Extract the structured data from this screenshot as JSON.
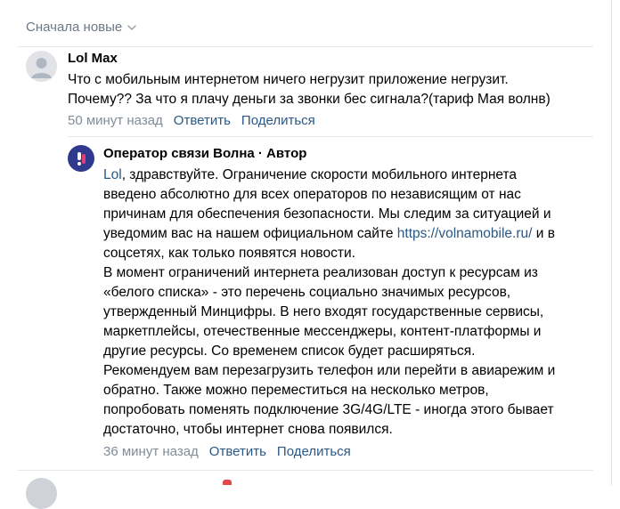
{
  "sort": {
    "label": "Сначала новые",
    "icon": "chevron-down-icon"
  },
  "comment": {
    "author": "Lol Max",
    "text": "Что с мобильным интернетом ничего негрузит приложение негрузит.\nПочему?? За что я плачу деньги за звонки бес сигнала?(тариф Мая волнв)",
    "time": "50 минут назад",
    "reply_label": "Ответить",
    "share_label": "Поделиться"
  },
  "reply": {
    "author": "Оператор связи Волна · Автор",
    "mention": "Lol",
    "text_part1": ", здравствуйте. Ограничение скорости мобильного интернета\nвведено абсолютно для всех операторов по независящим от нас\nпричинам для обеспечения безопасности. Мы следим за ситуацией и\nуведомим вас на нашем официальном сайте ",
    "link": "https://volnamobile.ru/",
    "text_part2": " и в\nсоцсетях, как только появятся новости.\nВ момент ограничений интернета реализован доступ к ресурсам из\n«белого списка» - это перечень социально значимых ресурсов,\nутвержденный Минцифры. В него входят государственные сервисы,\nмаркетплейсы, отечественные мессенджеры, контент-платформы и\nдругие ресурсы. Со временем список будет расширяться.\nРекомендуем вам перезагрузить телефон или перейти в авиарежим и\nобратно. Также можно переместиться на несколько метров,\nпопробовать поменять подключение 3G/4G/LTE - иногда этого бывает\nдостаточно, чтобы интернет снова появился.",
    "time": "36 минут назад",
    "reply_label": "Ответить",
    "share_label": "Поделиться"
  },
  "colors": {
    "link": "#2a5885",
    "meta": "#818c99",
    "operator_avatar": "#2f3a8f"
  }
}
